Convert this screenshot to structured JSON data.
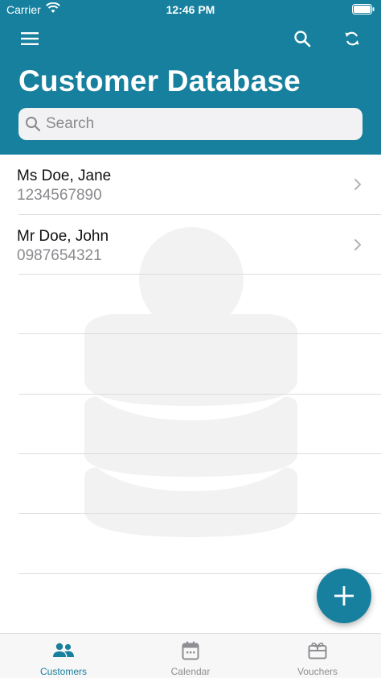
{
  "status_bar": {
    "carrier": "Carrier",
    "time": "12:46 PM"
  },
  "header": {
    "title": "Customer Database",
    "menu_icon": "hamburger-menu-icon",
    "search_icon": "magnifier-icon",
    "sync_icon": "sync-arrows-icon"
  },
  "search": {
    "placeholder": "Search",
    "value": ""
  },
  "customers": [
    {
      "name": "Ms Doe, Jane",
      "phone": "1234567890"
    },
    {
      "name": "Mr Doe, John",
      "phone": "0987654321"
    }
  ],
  "fab": {
    "icon": "plus-icon"
  },
  "tabs": [
    {
      "label": "Customers",
      "icon": "people-icon",
      "active": true
    },
    {
      "label": "Calendar",
      "icon": "calendar-icon",
      "active": false
    },
    {
      "label": "Vouchers",
      "icon": "gift-card-icon",
      "active": false
    }
  ],
  "colors": {
    "brand": "#17809e",
    "tab_inactive": "#8e8e93"
  }
}
